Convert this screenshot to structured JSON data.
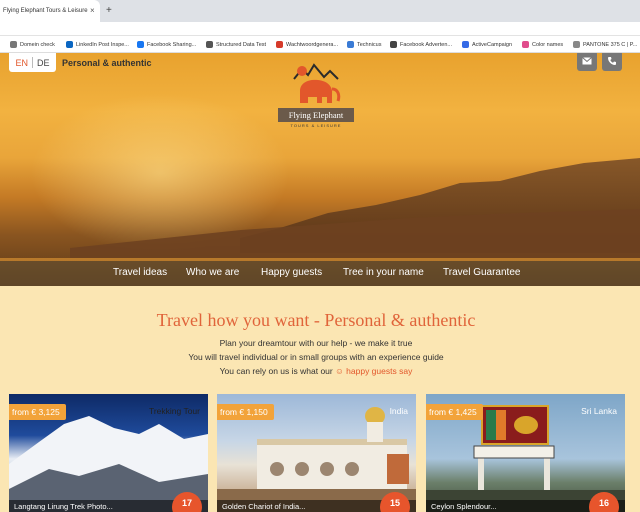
{
  "browser": {
    "tab_title": "Flying Elephant Tours & Leisure",
    "close_glyph": "×",
    "new_tab_glyph": "+",
    "bookmarks": [
      {
        "label": "Domein check",
        "color": "#777777"
      },
      {
        "label": "LinkedIn Post Inspe...",
        "color": "#0a66c2"
      },
      {
        "label": "Facebook Sharing...",
        "color": "#1877f2"
      },
      {
        "label": "Structured Data Test",
        "color": "#555555"
      },
      {
        "label": "Wachtwoordgenera...",
        "color": "#d63a2a"
      },
      {
        "label": "Technicus",
        "color": "#3a7bd5"
      },
      {
        "label": "Facebook Adverten...",
        "color": "#444444"
      },
      {
        "label": "ActiveCampaign",
        "color": "#356ae6"
      },
      {
        "label": "Color names",
        "color": "#e04c8c"
      },
      {
        "label": "PANTONE 375 C | P...",
        "color": "#888888"
      }
    ]
  },
  "header": {
    "lang_en": "EN",
    "lang_de": "DE",
    "tagline": "Personal & authentic",
    "logo_name": "Flying Elephant",
    "logo_sub": "TOURS & LEISURE",
    "email_icon": "envelope-icon",
    "phone_icon": "phone-icon"
  },
  "nav": {
    "items": [
      "Travel ideas",
      "Who we are",
      "Happy guests",
      "Tree in your name",
      "Travel Guarantee"
    ]
  },
  "main": {
    "headline": "Travel how you want - Personal & authentic",
    "line1": "Plan your dreamtour with our help - we make it true",
    "line2": "You will travel individual or in small groups with an experience guide",
    "line3_prefix": "You can rely on us is what our",
    "line3_link": "☺ happy guests say"
  },
  "cards": [
    {
      "price": "from € 3,125",
      "category": "Trekking Tour",
      "title": "Langtang Lirung Trek Photo...",
      "days": "17"
    },
    {
      "price": "from € 1,150",
      "category": "India",
      "title": "Golden Chariot of India...",
      "days": "15"
    },
    {
      "price": "from € 1,425",
      "category": "Sri Lanka",
      "title": "Ceylon Splendour...",
      "days": "16"
    }
  ],
  "colors": {
    "accent": "#e2572b",
    "price_tag": "#f2a33a",
    "content_bg": "#fbe6b3"
  }
}
